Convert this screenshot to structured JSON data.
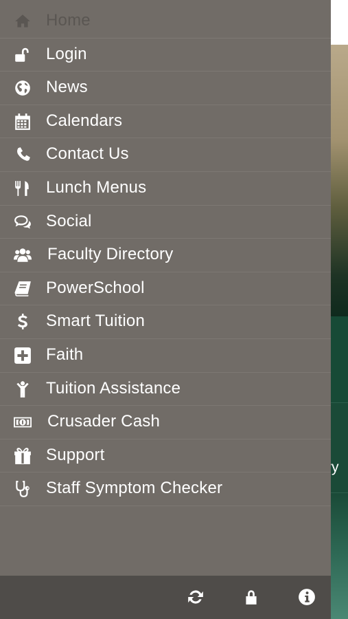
{
  "menu": {
    "items": [
      {
        "label": "Home",
        "icon": "home-icon"
      },
      {
        "label": "Login",
        "icon": "unlock-icon"
      },
      {
        "label": "News",
        "icon": "globe-icon"
      },
      {
        "label": "Calendars",
        "icon": "calendar-icon"
      },
      {
        "label": "Contact Us",
        "icon": "phone-icon"
      },
      {
        "label": "Lunch Menus",
        "icon": "cutlery-icon"
      },
      {
        "label": "Social",
        "icon": "chat-bubbles-icon"
      },
      {
        "label": "Faculty Directory",
        "icon": "users-icon"
      },
      {
        "label": "PowerSchool",
        "icon": "book-icon"
      },
      {
        "label": "Smart Tuition",
        "icon": "dollar-icon"
      },
      {
        "label": "Faith",
        "icon": "plus-square-icon"
      },
      {
        "label": "Tuition Assistance",
        "icon": "child-icon"
      },
      {
        "label": "Crusader Cash",
        "icon": "money-icon"
      },
      {
        "label": "Support",
        "icon": "gift-icon"
      },
      {
        "label": "Staff Symptom Checker",
        "icon": "stethoscope-icon"
      }
    ]
  },
  "bottom_bar": {
    "icons": [
      "refresh-icon",
      "lock-icon",
      "info-icon"
    ]
  },
  "background": {
    "fragment_text": "ry"
  },
  "colors": {
    "drawer": "#716c67",
    "bottom_bar": "#4f4c49",
    "accent_green": "#174a36"
  }
}
